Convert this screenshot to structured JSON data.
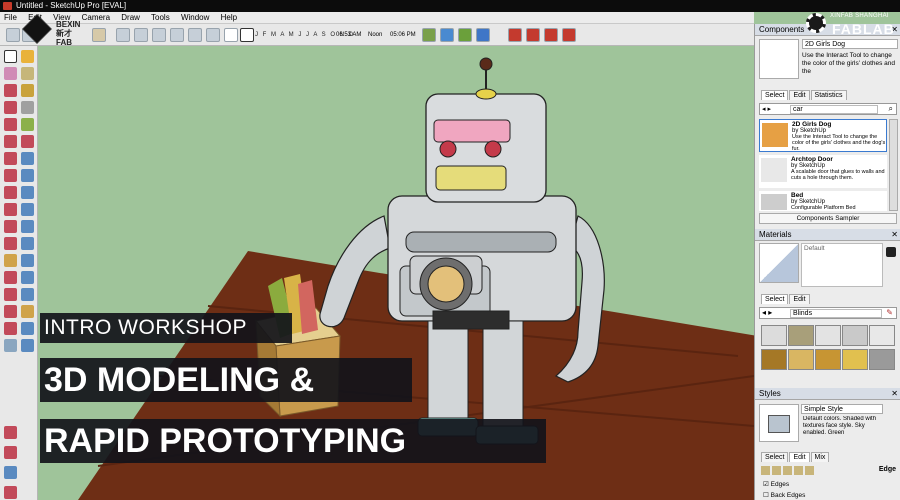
{
  "window": {
    "title": "Untitled - SketchUp Pro [EVAL]"
  },
  "menu": [
    "File",
    "Edit",
    "View",
    "Camera",
    "Draw",
    "Tools",
    "Window",
    "Help"
  ],
  "logos": {
    "left_text_line1": "BEXIN",
    "left_text_line2": "新才FAB",
    "right_small": "XINFAB SHANGHAI",
    "right_big": "FABLAB"
  },
  "toolbar": {
    "months": "J F M A M J J A S O N D",
    "time_a": "06:53 AM",
    "noon": "Noon",
    "time_b": "05:06 PM"
  },
  "components": {
    "header": "Components",
    "preview_title": "2D Girls Dog",
    "preview_desc": "Use the Interact Tool to change the color of the girls' clothes and the",
    "tab_select": "Select",
    "tab_edit": "Edit",
    "tab_statistics": "Statistics",
    "search_value": "car",
    "items": [
      {
        "name": "2D Girls Dog",
        "by": "by SketchUp",
        "desc": "Use the Interact Tool to change the color of the girls' clothes and the dog's fur."
      },
      {
        "name": "Archtop Door",
        "by": "by SketchUp",
        "desc": "A scalable door that glues to walls and cuts a hole through them."
      },
      {
        "name": "Bed",
        "by": "by SketchUp",
        "desc": "Configurable Platform Bed"
      }
    ],
    "footer": "Components Sampler"
  },
  "materials": {
    "header": "Materials",
    "current": "Default",
    "tab_select": "Select",
    "tab_edit": "Edit",
    "library": "Blinds"
  },
  "styles": {
    "header": "Styles",
    "name": "Simple Style",
    "desc": "Default colors. Shaded with textures face style. Sky enabled. Green",
    "tab_select": "Select",
    "tab_edit": "Edit",
    "tab_mix": "Mix",
    "section": "Edge",
    "options": [
      "Edges",
      "Back Edges"
    ]
  },
  "caption": {
    "line1": "INTRO WORKSHOP",
    "line2": "3D MODELING &",
    "line3": "RAPID PROTOTYPING"
  },
  "colors": {
    "sky_green": "#9fc49a",
    "table_wood": "#6e2e15",
    "robot_grey": "#d5d8da",
    "caption_bg": "#12141a",
    "panel_header": "#d7dde6"
  }
}
